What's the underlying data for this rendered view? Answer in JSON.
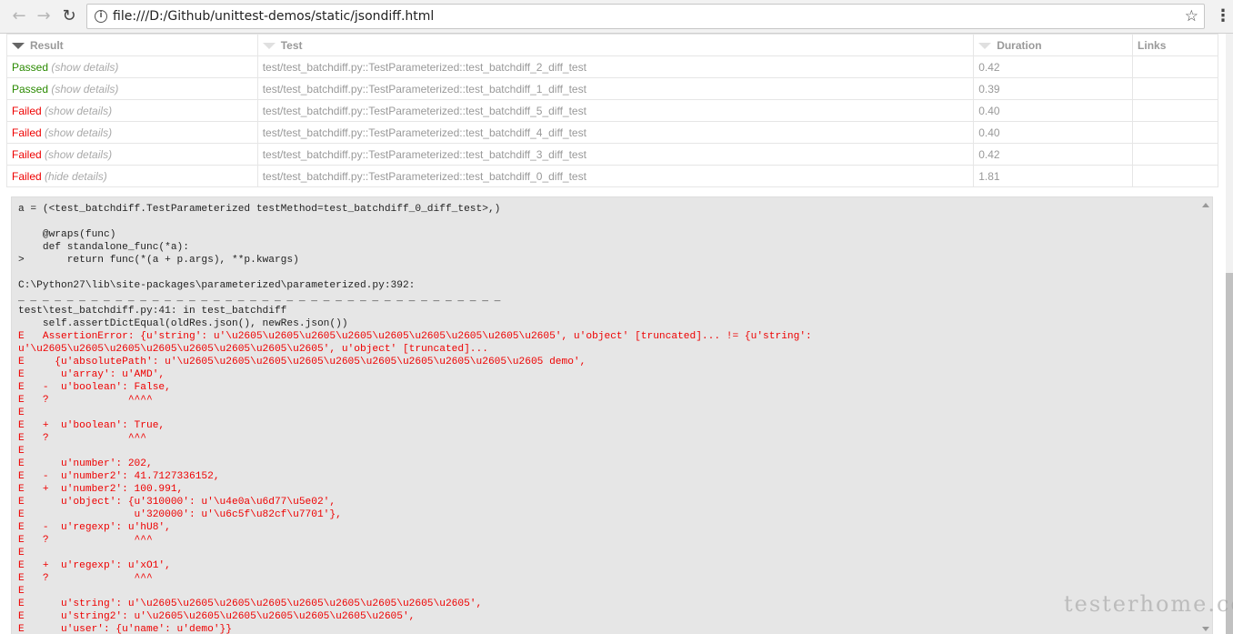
{
  "browser": {
    "url": "file:///D:/Github/unittest-demos/static/jsondiff.html",
    "back_icon": "arrow-left",
    "forward_icon": "arrow-right",
    "reload_icon": "reload",
    "info_icon": "info",
    "star_icon": "star",
    "menu_icon": "vertical-dots"
  },
  "table": {
    "headers": {
      "result": "Result",
      "test": "Test",
      "duration": "Duration",
      "links": "Links"
    },
    "rows": [
      {
        "status": "Passed",
        "details": "(show details)",
        "test": "test/test_batchdiff.py::TestParameterized::test_batchdiff_2_diff_test",
        "duration": "0.42"
      },
      {
        "status": "Passed",
        "details": "(show details)",
        "test": "test/test_batchdiff.py::TestParameterized::test_batchdiff_1_diff_test",
        "duration": "0.39"
      },
      {
        "status": "Failed",
        "details": "(show details)",
        "test": "test/test_batchdiff.py::TestParameterized::test_batchdiff_5_diff_test",
        "duration": "0.40"
      },
      {
        "status": "Failed",
        "details": "(show details)",
        "test": "test/test_batchdiff.py::TestParameterized::test_batchdiff_4_diff_test",
        "duration": "0.40"
      },
      {
        "status": "Failed",
        "details": "(show details)",
        "test": "test/test_batchdiff.py::TestParameterized::test_batchdiff_3_diff_test",
        "duration": "0.42"
      },
      {
        "status": "Failed",
        "details": "(hide details)",
        "test": "test/test_batchdiff.py::TestParameterized::test_batchdiff_0_diff_test",
        "duration": "1.81"
      }
    ]
  },
  "log": {
    "plain_top": "a = (<test_batchdiff.TestParameterized testMethod=test_batchdiff_0_diff_test>,)\n\n    @wraps(func)\n    def standalone_func(*a):\n>       return func(*(a + p.args), **p.kwargs)\n\nC:\\Python27\\lib\\site-packages\\parameterized\\parameterized.py:392:\n_ _ _ _ _ _ _ _ _ _ _ _ _ _ _ _ _ _ _ _ _ _ _ _ _ _ _ _ _ _ _ _ _ _ _ _ _ _ _ _\ntest\\test_batchdiff.py:41: in test_batchdiff\n    self.assertDictEqual(oldRes.json(), newRes.json())",
    "error": "E   AssertionError: {u'string': u'\\u2605\\u2605\\u2605\\u2605\\u2605\\u2605\\u2605\\u2605\\u2605', u'object' [truncated]... != {u'string':\nu'\\u2605\\u2605\\u2605\\u2605\\u2605\\u2605\\u2605\\u2605', u'object' [truncated]...\nE     {u'absolutePath': u'\\u2605\\u2605\\u2605\\u2605\\u2605\\u2605\\u2605\\u2605\\u2605\\u2605 demo',\nE      u'array': u'AMD',\nE   -  u'boolean': False,\nE   ?             ^^^^\nE\nE   +  u'boolean': True,\nE   ?             ^^^\nE\nE      u'number': 202,\nE   -  u'number2': 41.7127336152,\nE   +  u'number2': 100.991,\nE      u'object': {u'310000': u'\\u4e0a\\u6d77\\u5e02',\nE                  u'320000': u'\\u6c5f\\u82cf\\u7701'},\nE   -  u'regexp': u'hU8',\nE   ?              ^^^\nE\nE   +  u'regexp': u'xO1',\nE   ?              ^^^\nE\nE      u'string': u'\\u2605\\u2605\\u2605\\u2605\\u2605\\u2605\\u2605\\u2605\\u2605',\nE      u'string2': u'\\u2605\\u2605\\u2605\\u2605\\u2605\\u2605\\u2605',\nE      u'user': {u'name': u'demo'}}"
  },
  "watermark": "testerhome.com",
  "colors": {
    "passed": "#2a8a00",
    "failed": "#ee0000",
    "log_bg": "#e6e6e6"
  }
}
